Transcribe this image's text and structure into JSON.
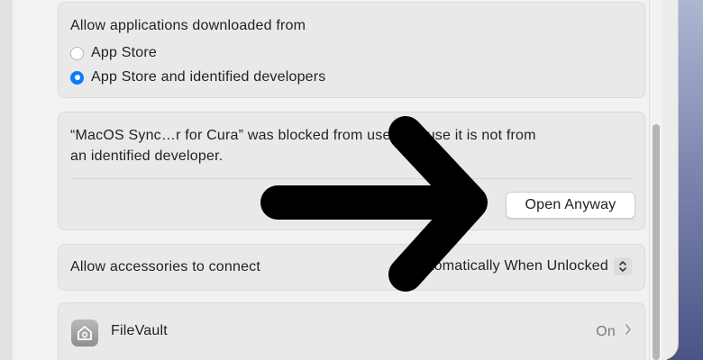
{
  "security": {
    "downloads": {
      "heading": "Allow applications downloaded from",
      "options": [
        {
          "label": "App Store",
          "selected": false
        },
        {
          "label": "App Store and identified developers",
          "selected": true
        }
      ]
    },
    "blocked": {
      "message_line1": "“MacOS Sync…r for Cura” was blocked from use because it is not from",
      "message_line2": "an identified developer.",
      "button_label": "Open Anyway"
    },
    "accessories": {
      "label": "Allow accessories to connect",
      "value": "Automatically When Unlocked"
    },
    "filevault": {
      "label": "FileVault",
      "status": "On"
    }
  },
  "colors": {
    "accent": "#0a7aff",
    "arrow": "#000000"
  },
  "icons": {
    "filevault": "house-shield-icon",
    "chevron": "chevron-right-icon",
    "stepper": "up-down-chevron-icon"
  }
}
